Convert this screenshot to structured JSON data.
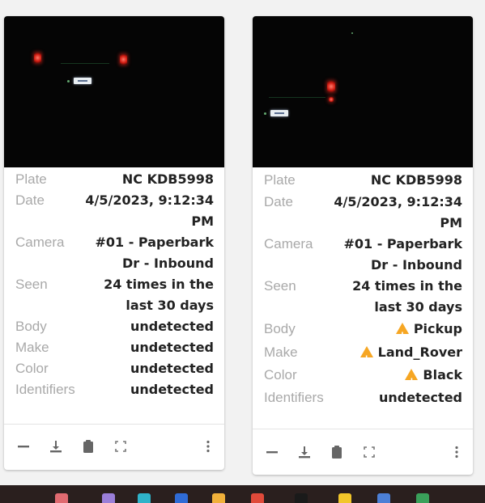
{
  "cards": [
    {
      "rows": [
        {
          "label": "Plate",
          "value": "NC KDB5998"
        },
        {
          "label": "Date",
          "value": "4/5/2023, 9:12:34\nPM"
        },
        {
          "label": "Camera",
          "value": "#01 - Paperbark\nDr - Inbound"
        },
        {
          "label": "Seen",
          "value": "24 times in the\nlast 30 days"
        },
        {
          "label": "Body",
          "value": "undetected"
        },
        {
          "label": "Make",
          "value": "undetected"
        },
        {
          "label": "Color",
          "value": "undetected"
        },
        {
          "label": "Identifiers",
          "value": "undetected"
        }
      ]
    },
    {
      "rows": [
        {
          "label": "Plate",
          "value": "NC KDB5998"
        },
        {
          "label": "Date",
          "value": "4/5/2023, 9:12:34\nPM"
        },
        {
          "label": "Camera",
          "value": "#01 - Paperbark\nDr - Inbound"
        },
        {
          "label": "Seen",
          "value": "24 times in the\nlast 30 days"
        },
        {
          "label": "Body",
          "value": "Pickup"
        },
        {
          "label": "Make",
          "value": "Land_Rover"
        },
        {
          "label": "Color",
          "value": "Black"
        },
        {
          "label": "Identifiers",
          "value": "undetected"
        }
      ]
    }
  ],
  "icons": {
    "collapse": "minus-icon",
    "download": "download-icon",
    "copy": "clipboard-icon",
    "expand": "fullscreen-icon",
    "more": "more-vertical-icon",
    "warning": "warning-triangle-icon"
  },
  "colors": {
    "label": "#a9a9a9",
    "value": "#222222",
    "warning": "#f6a623",
    "icon": "#666666"
  }
}
